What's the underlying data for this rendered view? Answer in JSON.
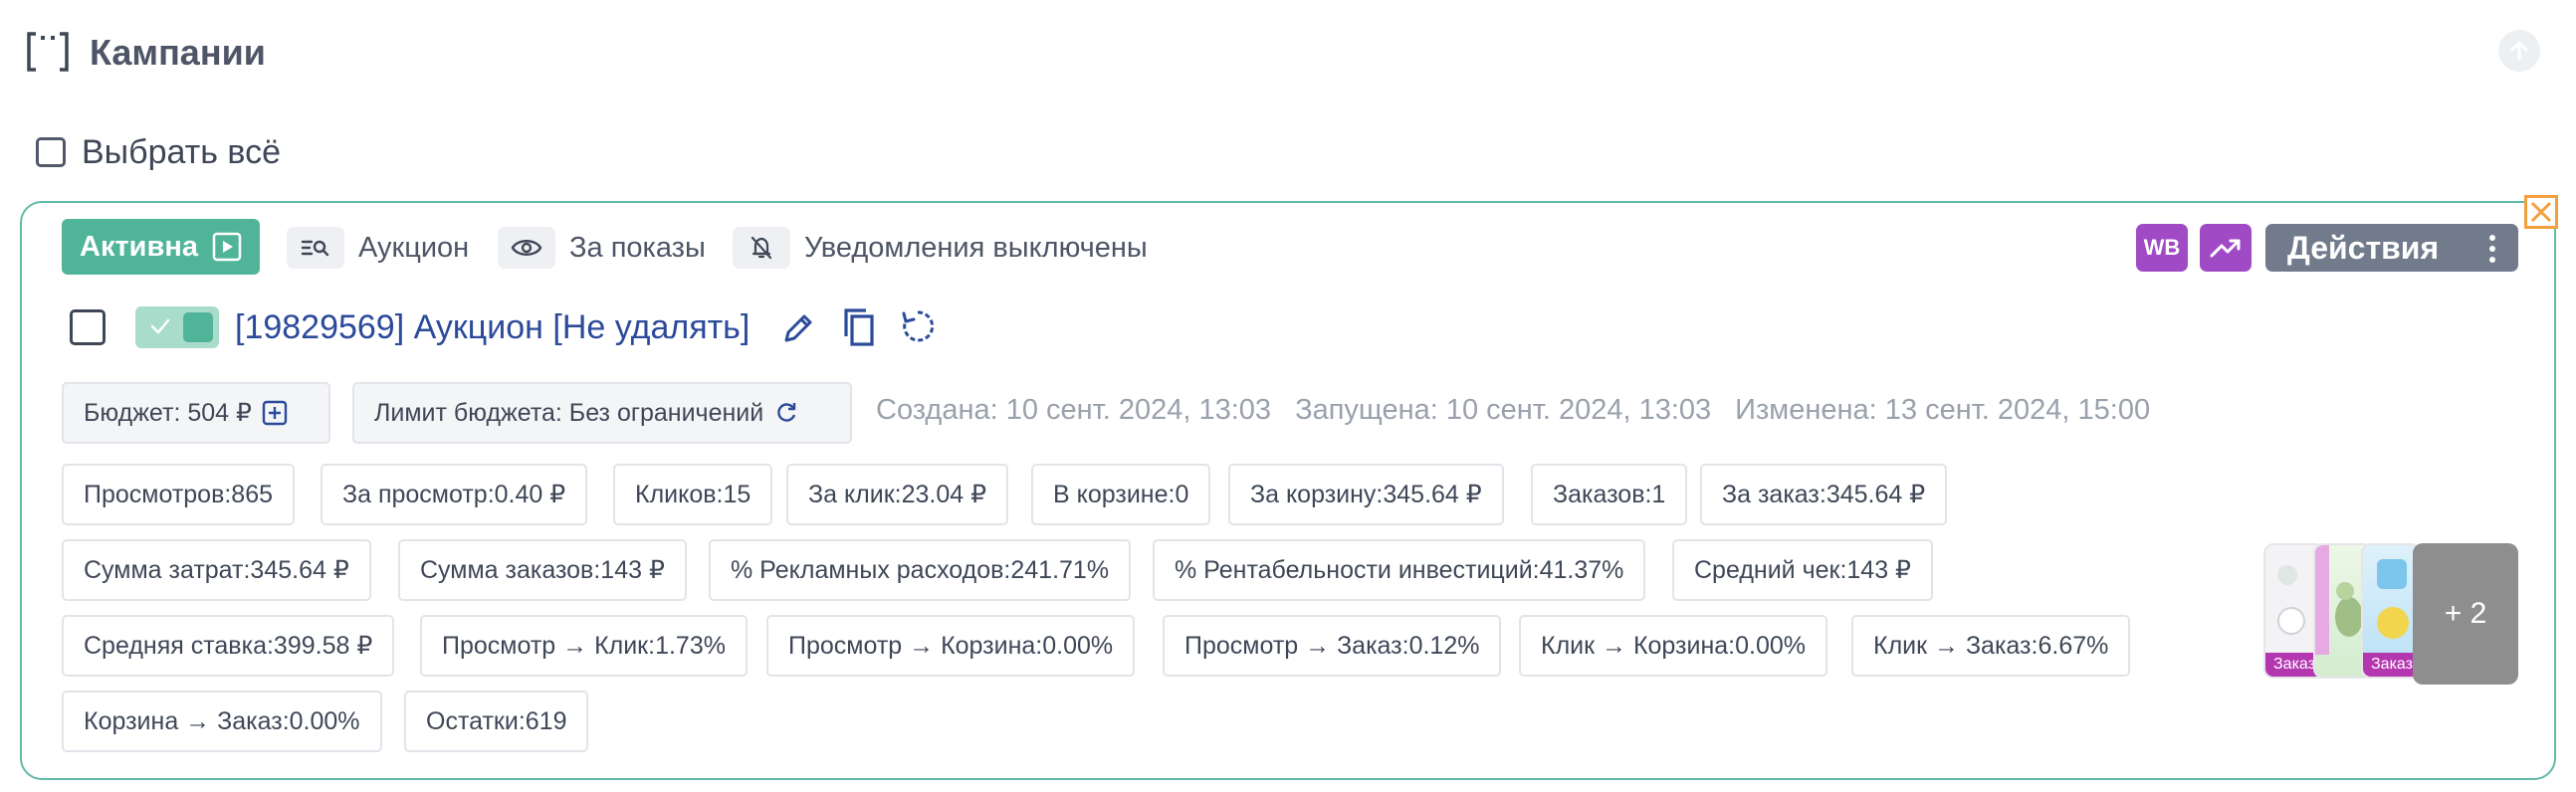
{
  "page": {
    "title": "Кампании"
  },
  "select_all": {
    "label": "Выбрать всё"
  },
  "campaign": {
    "status": "Активна",
    "tags": [
      {
        "icon": "search-list-icon",
        "label": "Аукцион"
      },
      {
        "icon": "eye-icon",
        "label": "За показы"
      },
      {
        "icon": "bell-off-icon",
        "label": "Уведомления выключены"
      }
    ],
    "wb_label": "WB",
    "actions_label": "Действия",
    "name": "[19829569] Аукцион [Не удалять]",
    "budget": "Бюджет: 504 ₽",
    "budget_limit": "Лимит бюджета: Без ограничений",
    "created": "Создана: 10 сент. 2024, 13:03",
    "launched": "Запущена: 10 сент. 2024, 13:03",
    "modified": "Изменена: 13 сент. 2024, 15:00",
    "metrics_rows": [
      [
        "Просмотров:865",
        "За просмотр:0.40 ₽",
        "Кликов:15",
        "За клик:23.04 ₽",
        "В корзине:0",
        "За корзину:345.64 ₽",
        "Заказов:1",
        "За заказ:345.64 ₽"
      ],
      [
        "Сумма затрат:345.64 ₽",
        "Сумма заказов:143 ₽",
        "% Рекламных расходов:241.71%",
        "% Рентабельности инвестиций:41.37%",
        "Средний чек:143 ₽"
      ],
      [
        "Средняя ставка:399.58 ₽",
        "Просмотр → Клик:1.73%",
        "Просмотр → Корзина:0.00%",
        "Просмотр → Заказ:0.12%",
        "Клик → Корзина:0.00%",
        "Клик → Заказ:6.67%"
      ],
      [
        "Корзина → Заказ:0.00%",
        "Остатки:619"
      ]
    ],
    "thumbnail_labels": [
      "Заказ",
      "Заказ"
    ],
    "more_label": "+ 2"
  },
  "colors": {
    "accent_green": "#50b598",
    "card_border": "#5fbba7",
    "link_blue": "#2b4a9a",
    "wb_purple": "#a04bc5",
    "actions_gray": "#727b8c",
    "warning_orange": "#f2a03c"
  }
}
